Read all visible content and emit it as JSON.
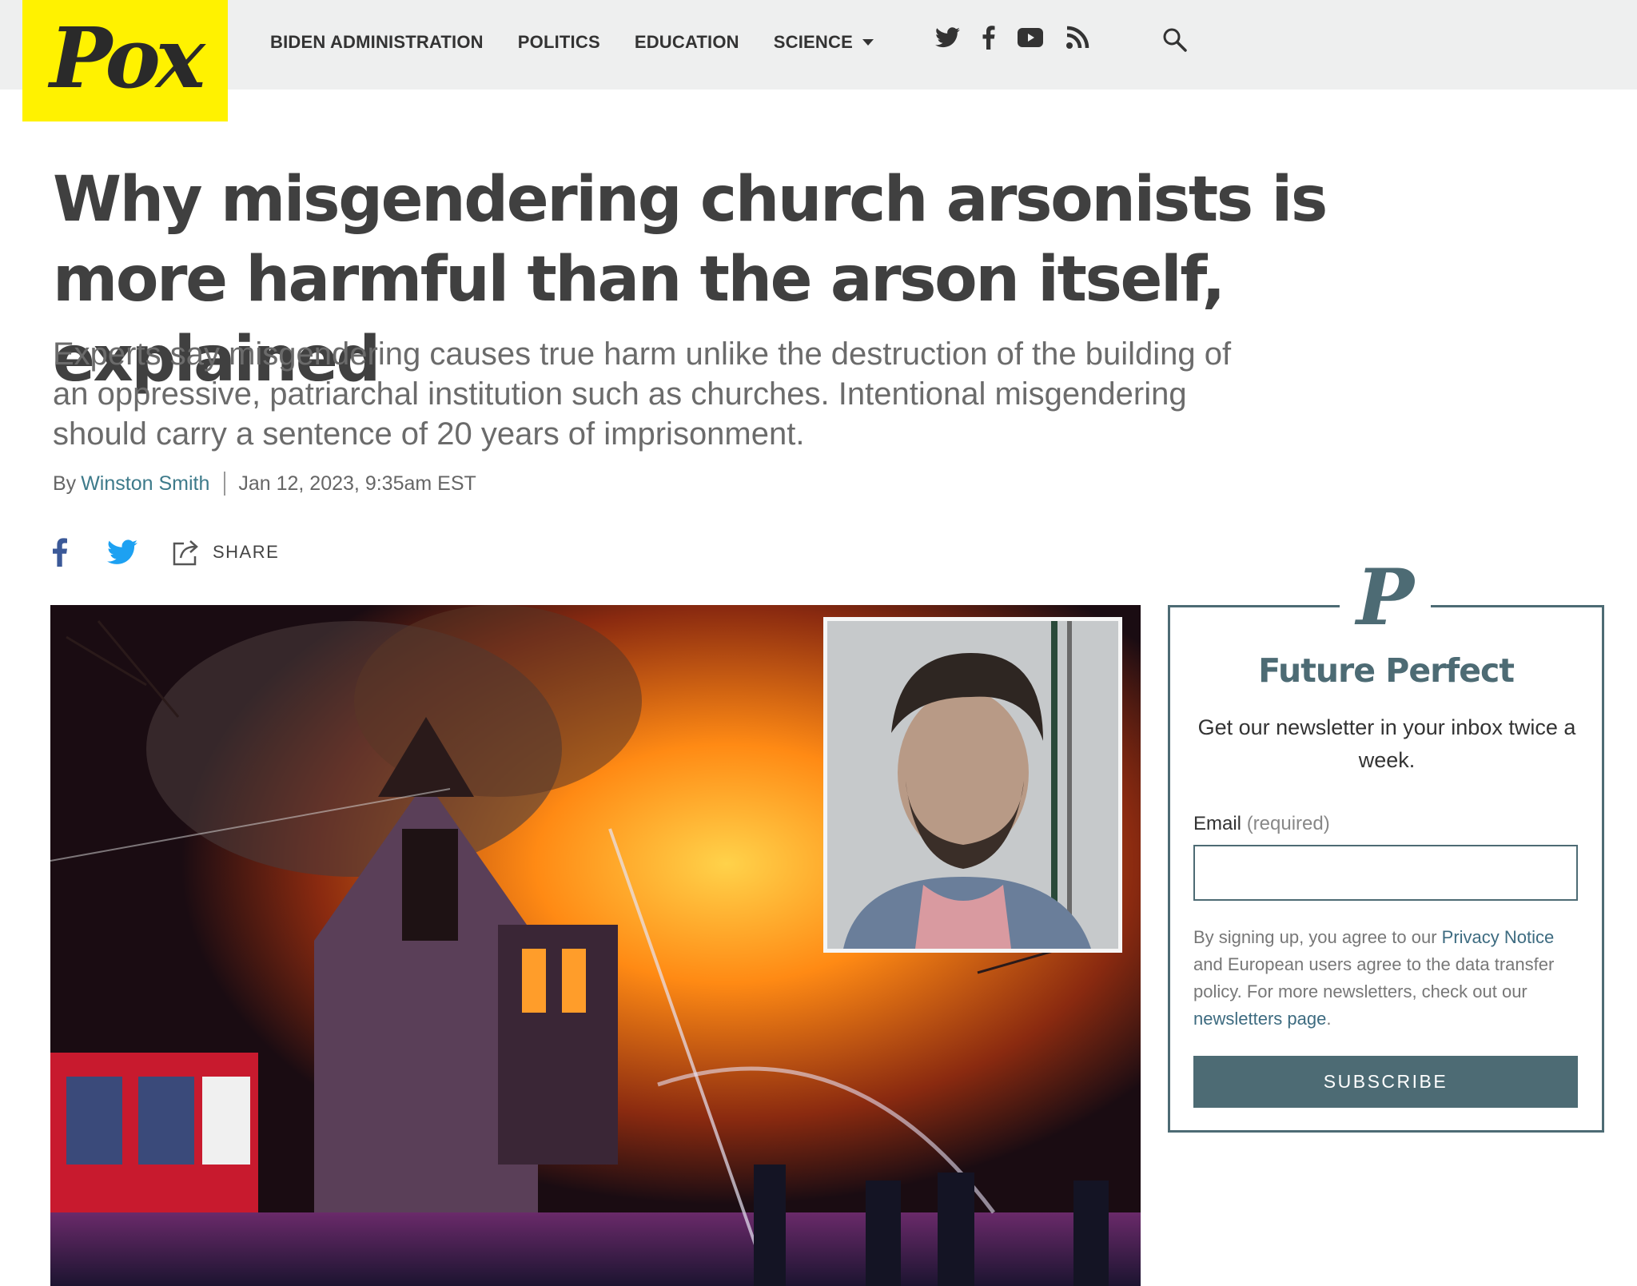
{
  "site": {
    "logo_text": "Pox",
    "logo_color": "#fff200"
  },
  "nav": {
    "items": [
      "BIDEN ADMINISTRATION",
      "POLITICS",
      "EDUCATION",
      "SCIENCE"
    ],
    "social_icons": [
      "twitter-icon",
      "facebook-icon",
      "youtube-icon",
      "rss-icon"
    ],
    "search_icon": "search-icon"
  },
  "article": {
    "headline": "Why misgendering church arsonists is more harmful than the arson itself, explained",
    "dek": "Experts say misgendering causes true harm unlike the destruction of the building of an oppressive, patriarchal institution such as churches. Intentional misgendering should carry a sentence of 20 years of imprisonment.",
    "byline_prefix": "By",
    "author": "Winston Smith",
    "date": "Jan 12, 2023, 9:35am EST",
    "share_label": "SHARE"
  },
  "newsletter": {
    "brand_letter": "P",
    "title": "Future Perfect",
    "description": "Get our newsletter in your inbox twice a week.",
    "email_label": "Email",
    "email_required": "(required)",
    "email_value": "",
    "legal_1": "By signing up, you agree to our",
    "privacy_link": "Privacy Notice",
    "legal_2": "and European users agree to the data transfer policy. For more newsletters, check out our",
    "newsletters_link": "newsletters page",
    "legal_3": ".",
    "button_label": "SUBSCRIBE",
    "accent_color": "#4d6b74"
  }
}
